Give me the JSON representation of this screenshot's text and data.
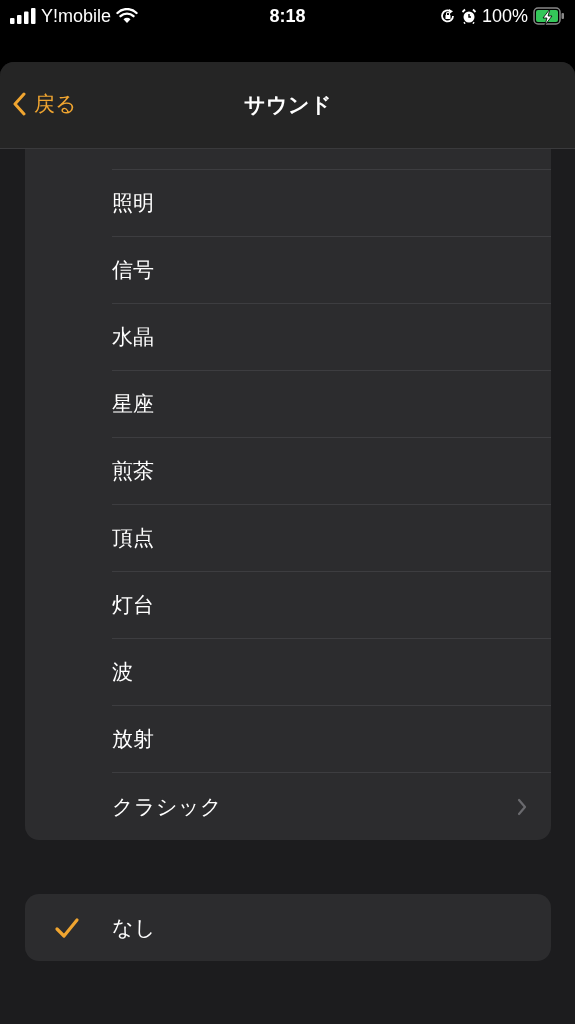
{
  "status_bar": {
    "carrier": "Y!mobile",
    "time": "8:18",
    "battery": "100%",
    "charging": true
  },
  "nav": {
    "back": "戻る",
    "title": "サウンド"
  },
  "sounds": [
    {
      "label": "照明",
      "kind": "option",
      "selected": false
    },
    {
      "label": "信号",
      "kind": "option",
      "selected": false
    },
    {
      "label": "水晶",
      "kind": "option",
      "selected": false
    },
    {
      "label": "星座",
      "kind": "option",
      "selected": false
    },
    {
      "label": "煎茶",
      "kind": "option",
      "selected": false
    },
    {
      "label": "頂点",
      "kind": "option",
      "selected": false
    },
    {
      "label": "灯台",
      "kind": "option",
      "selected": false
    },
    {
      "label": "波",
      "kind": "option",
      "selected": false
    },
    {
      "label": "放射",
      "kind": "option",
      "selected": false
    },
    {
      "label": "クラシック",
      "kind": "submenu",
      "selected": false
    }
  ],
  "none_option": {
    "label": "なし",
    "selected": true
  }
}
